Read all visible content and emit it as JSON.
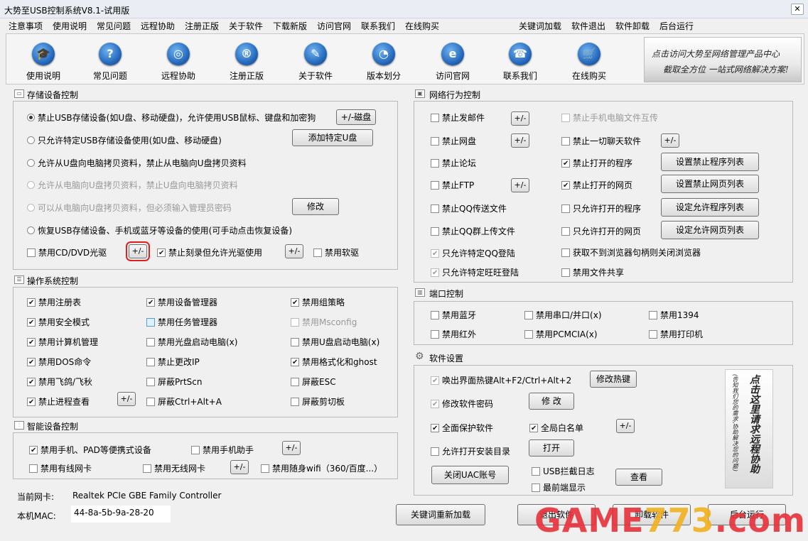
{
  "window": {
    "title": "大势至USB控制系统V8.1-试用版",
    "close": "✕"
  },
  "menu": {
    "left": [
      "注意事项",
      "使用说明",
      "常见问题",
      "远程协助",
      "注册正版",
      "关于软件",
      "下载新版",
      "访问官网",
      "联系我们",
      "在线购买"
    ],
    "right": [
      "关键词加载",
      "软件退出",
      "软件卸载",
      "后台运行"
    ]
  },
  "toolbar": [
    {
      "label": "使用说明",
      "icon": "graduation-cap-icon",
      "glyph": "🎓"
    },
    {
      "label": "常见问题",
      "icon": "question-icon",
      "glyph": "?"
    },
    {
      "label": "远程协助",
      "icon": "globe-icon",
      "glyph": "◎"
    },
    {
      "label": "注册正版",
      "icon": "registered-icon",
      "glyph": "®"
    },
    {
      "label": "关于软件",
      "icon": "document-icon",
      "glyph": "✎"
    },
    {
      "label": "版本划分",
      "icon": "pie-chart-icon",
      "glyph": "◔"
    },
    {
      "label": "访问官网",
      "icon": "ie-icon",
      "glyph": "e"
    },
    {
      "label": "联系我们",
      "icon": "phone-icon",
      "glyph": "☎"
    },
    {
      "label": "在线购买",
      "icon": "cart-icon",
      "glyph": "🛒"
    }
  ],
  "banner": {
    "line1": "点击访问大势至网络管理产品中心",
    "line2": "截取全方位 一站式网络解决方案!"
  },
  "storage": {
    "title": "存储设备控制",
    "radios": [
      {
        "label": "禁止USB存储设备(如U盘、移动硬盘)，允许使用USB鼠标、键盘和加密狗",
        "checked": true,
        "disabled": false
      },
      {
        "label": "只允许特定USB存储设备使用(如U盘、移动硬盘)",
        "checked": false,
        "disabled": false
      },
      {
        "label": "允许从U盘向电脑拷贝资料，禁止从电脑向U盘拷贝资料",
        "checked": false,
        "disabled": false
      },
      {
        "label": "允许从电脑向U盘拷贝资料，禁止U盘向电脑拷贝资料",
        "checked": false,
        "disabled": true
      },
      {
        "label": "可以从电脑向U盘拷贝资料，但必须输入管理员密码",
        "checked": false,
        "disabled": true
      },
      {
        "label": "恢复USB存储设备、手机或蓝牙等设备的使用(可手动点击恢复设备)",
        "checked": false,
        "disabled": false
      }
    ],
    "btn_disk": "+/-磁盘",
    "btn_add": "添加特定U盘",
    "btn_modify": "修改",
    "cd_label": "禁用CD/DVD光驱",
    "burn_label": "禁止刻录但允许光驱使用",
    "floppy_label": "禁用软驱",
    "pm": "+/-"
  },
  "os": {
    "title": "操作系统控制",
    "col1": [
      {
        "label": "禁用注册表",
        "checked": true
      },
      {
        "label": "禁用安全模式",
        "checked": true
      },
      {
        "label": "禁用计算机管理",
        "checked": true
      },
      {
        "label": "禁用DOS命令",
        "checked": true
      },
      {
        "label": "禁用飞鸽/飞秋",
        "checked": true
      },
      {
        "label": "禁止进程查看",
        "checked": true
      }
    ],
    "col2": [
      {
        "label": "禁用设备管理器",
        "checked": true
      },
      {
        "label": "禁用任务管理器",
        "checked": false
      },
      {
        "label": "禁用光盘启动电脑(x)",
        "checked": false
      },
      {
        "label": "禁止更改IP",
        "checked": false
      },
      {
        "label": "屏蔽PrtScn",
        "checked": false
      },
      {
        "label": "屏蔽Ctrl+Alt+A",
        "checked": false
      }
    ],
    "col3": [
      {
        "label": "禁用组策略",
        "checked": true,
        "disabled": false
      },
      {
        "label": "禁用Msconfig",
        "checked": false,
        "disabled": true
      },
      {
        "label": "禁用U盘启动电脑(x)",
        "checked": false,
        "disabled": false
      },
      {
        "label": "禁用格式化和ghost",
        "checked": true,
        "disabled": false
      },
      {
        "label": "屏蔽ESC",
        "checked": false,
        "disabled": false
      },
      {
        "label": "屏蔽剪切板",
        "checked": false,
        "disabled": false
      }
    ],
    "pm": "+/-"
  },
  "smart": {
    "title": "智能设备控制",
    "phone": "禁用手机、PAD等便携式设备",
    "assistant": "禁用手机助手",
    "wired": "禁用有线网卡",
    "wireless": "禁用无线网卡",
    "wifi": "禁用随身wifi（360/百度...）",
    "pm": "+/-"
  },
  "nic": {
    "label": "当前网卡:",
    "value": "Realtek PCIe GBE Family Controller",
    "mac_label": "本机MAC:",
    "mac_value": "44-8a-5b-9a-28-20"
  },
  "network": {
    "title": "网络行为控制",
    "left": [
      {
        "label": "禁止发邮件",
        "checked": false,
        "disabled": false
      },
      {
        "label": "禁止网盘",
        "checked": false,
        "disabled": false
      },
      {
        "label": "禁止论坛",
        "checked": false,
        "disabled": false
      },
      {
        "label": "禁止FTP",
        "checked": false,
        "disabled": false
      },
      {
        "label": "禁止QQ传送文件",
        "checked": false,
        "disabled": false
      },
      {
        "label": "禁止QQ群上传文件",
        "checked": false,
        "disabled": false
      },
      {
        "label": "只允许特定QQ登陆",
        "checked": true,
        "disabled": true
      },
      {
        "label": "只允许特定旺旺登陆",
        "checked": true,
        "disabled": true
      }
    ],
    "right": [
      {
        "label": "禁止手机电脑文件互传",
        "checked": false,
        "disabled": true
      },
      {
        "label": "禁止一切聊天软件",
        "checked": false,
        "disabled": false
      },
      {
        "label": "禁止打开的程序",
        "checked": true,
        "disabled": false
      },
      {
        "label": "禁止打开的网页",
        "checked": true,
        "disabled": false
      },
      {
        "label": "只允许打开的程序",
        "checked": false,
        "disabled": false
      },
      {
        "label": "只允许打开的网页",
        "checked": false,
        "disabled": false
      },
      {
        "label": "获取不到浏览器句柄则关闭浏览器",
        "checked": false,
        "disabled": false
      },
      {
        "label": "禁用文件共享",
        "checked": false,
        "disabled": false
      }
    ],
    "btns": [
      "设置禁止程序列表",
      "设置禁止网页列表",
      "设定允许程序列表",
      "设定允许网页列表"
    ],
    "pm": "+/-"
  },
  "port": {
    "title": "端口控制",
    "items": [
      "禁用蓝牙",
      "禁用串口/并口(x)",
      "禁用1394",
      "禁用红外",
      "禁用PCMCIA(x)",
      "禁用打印机"
    ]
  },
  "settings": {
    "title": "软件设置",
    "hotkey": "唤出界面热键Alt+F2/Ctrl+Alt+2",
    "btn_hotkey": "修改热键",
    "pwd": "修改软件密码",
    "btn_pwd": "修 改",
    "protect": "全面保护软件",
    "whitelist": "全局白名单",
    "pm": "+/-",
    "install": "允许打开安装目录",
    "btn_open": "打开",
    "btn_uac": "关闭UAC账号",
    "usblog": "USB拦截日志",
    "topmost": "最前端显示",
    "btn_view": "查看",
    "side_text": "点击这里请求远程协助",
    "side_small": "(告知我们您的需求,协助解决您的问题)"
  },
  "footer": {
    "reload": "关键词重新加载",
    "quit": "退出软件",
    "uninstall": "卸载软件",
    "background": "后台运行"
  },
  "watermark": {
    "a": "GAME",
    "b": "773",
    "c": ".com",
    "color_a": "#e8303a",
    "color_b": "#f2b01e",
    "color_c": "#e8303a"
  }
}
